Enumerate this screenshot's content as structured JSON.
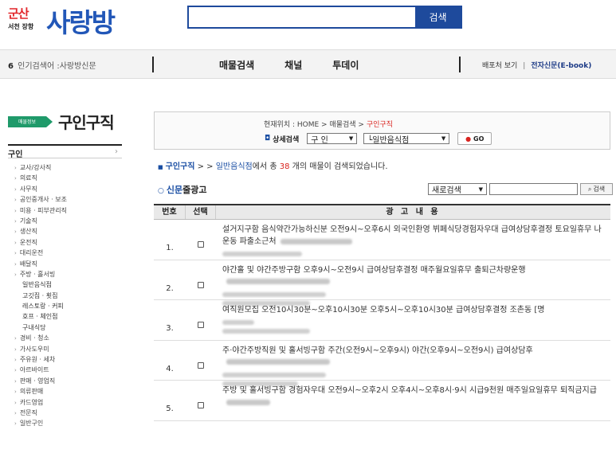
{
  "header": {
    "logo_small": "군산",
    "logo_tiny": "서천 장항",
    "logo_big": "사랑방",
    "search_button": "검색"
  },
  "nav": {
    "popular": "인기검색어 :사랑방신문",
    "links": [
      "매물검색",
      "채널",
      "투데이"
    ],
    "distribution": "배포처 보기",
    "ebook": "전자신문(E-book)"
  },
  "sidebar": {
    "badge": "매물정보",
    "heading": "구인구직",
    "category": "구인",
    "items": [
      {
        "label": "교사/강사직",
        "sub": false
      },
      {
        "label": "의료직",
        "sub": false
      },
      {
        "label": "사무직",
        "sub": false
      },
      {
        "label": "공인중개사 · 보조",
        "sub": false
      },
      {
        "label": "미용 · 피부관리직",
        "sub": false
      },
      {
        "label": "기술직",
        "sub": false
      },
      {
        "label": "생산직",
        "sub": false
      },
      {
        "label": "운전직",
        "sub": false
      },
      {
        "label": "대리운전",
        "sub": false
      },
      {
        "label": "배달직",
        "sub": false
      },
      {
        "label": "주방 · 홀서빙",
        "sub": false
      },
      {
        "label": "일반음식점",
        "sub": true
      },
      {
        "label": "고깃집 · 횟집",
        "sub": true
      },
      {
        "label": "레스토랑 · 커피",
        "sub": true
      },
      {
        "label": "호프 · 체인점",
        "sub": true
      },
      {
        "label": "구내식당",
        "sub": true
      },
      {
        "label": "경비 · 청소",
        "sub": false
      },
      {
        "label": "가사도우미",
        "sub": false
      },
      {
        "label": "주유원 · 세차",
        "sub": false
      },
      {
        "label": "아르바이트",
        "sub": false
      },
      {
        "label": "판매 · 영업직",
        "sub": false
      },
      {
        "label": "의류판매",
        "sub": false
      },
      {
        "label": "카드영업",
        "sub": false
      },
      {
        "label": "전문직",
        "sub": false
      },
      {
        "label": "일반구인",
        "sub": false
      }
    ]
  },
  "location": {
    "path_prefix": "현재위치 : HOME > 매물검색 > ",
    "path_current": "구인구직",
    "detail_label": "상세검색",
    "select1": "구 인",
    "select2": "└일반음식점",
    "go": "GO"
  },
  "result": {
    "cat": "구인구직",
    "sep": " > > ",
    "sub": "일반음식점",
    "mid": "에서 총 ",
    "count": "38",
    "tail": " 개의 매물이 검색되었습니다."
  },
  "ads": {
    "title_new": "신문",
    "title_rest": "줄광고",
    "sort_select": "새로검색",
    "search_button": "검색"
  },
  "table": {
    "headers": [
      "번호",
      "선택",
      "광 고 내 용"
    ],
    "rows": [
      {
        "no": "1.",
        "text": "설거지구함 음식약간가능하신분 오전9시~오후6시 외국인환영 뷔페식당경험자우대 급여상담후결정 토요일휴무 나운동 파출소근처"
      },
      {
        "no": "2.",
        "text": "야간홀 및 야간주방구함 오후9시~오전9시 급여상담후결정 매주월요일휴무 출퇴근차량운행"
      },
      {
        "no": "3.",
        "text": "여직원모집 오전10시30분~오후10시30분 오후5시~오후10시30분 급여상담후결정 조촌동 [명"
      },
      {
        "no": "4.",
        "text": "주·야간주방직원 및 홀서빙구함 주간(오전9시~오후9시) 야간(오후9시~오전9시) 급여상담후"
      },
      {
        "no": "5.",
        "text": "주방 및 홀서빙구함 경험자우대 오전9시~오후2시 오후4시~오후8시·9시 시급9천원 매주일요일휴무 퇴직금지급"
      }
    ]
  }
}
